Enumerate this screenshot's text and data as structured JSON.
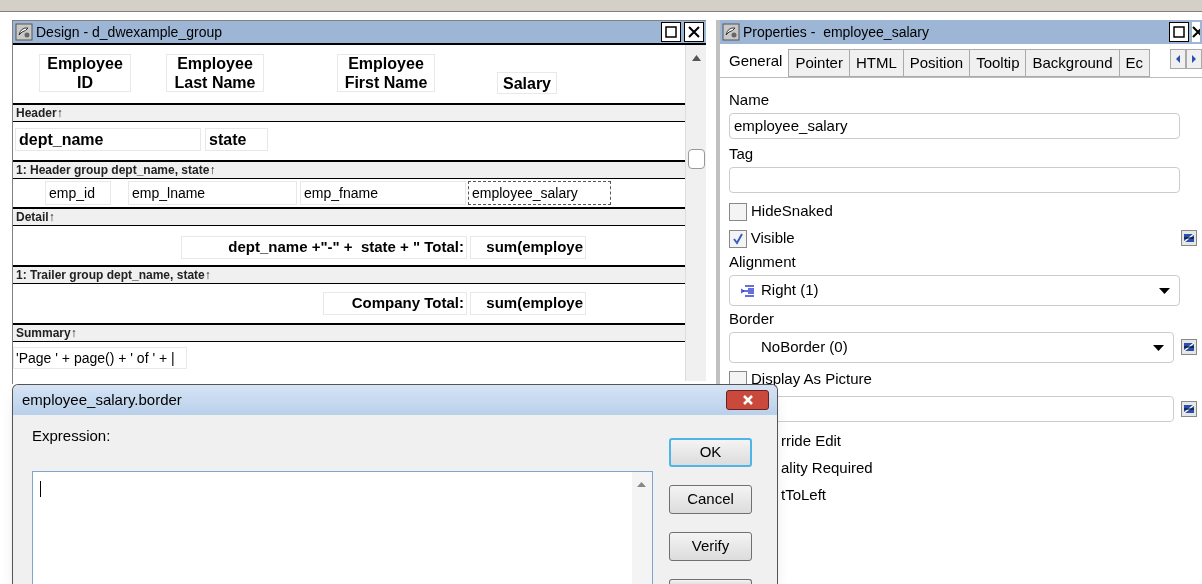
{
  "design_window": {
    "title": "Design - d_dwexample_group",
    "rows": [
      {
        "kind": "headings",
        "fields": [
          {
            "text": "Employee\nID",
            "selected": false
          },
          {
            "text": "Employee\nLast Name",
            "selected": false
          },
          {
            "text": "Employee\nFirst Name",
            "selected": false
          },
          {
            "text": "Salary",
            "selected": false
          }
        ]
      },
      {
        "kind": "band",
        "label": "Header↑"
      },
      {
        "kind": "group",
        "fields": [
          {
            "text": "dept_name",
            "selected": false
          },
          {
            "text": "state",
            "selected": false
          }
        ]
      },
      {
        "kind": "band",
        "label": "1: Header group dept_name, state↑"
      },
      {
        "kind": "detail",
        "fields": [
          {
            "text": "emp_id",
            "selected": false
          },
          {
            "text": "emp_lname",
            "selected": false
          },
          {
            "text": "emp_fname",
            "selected": false
          },
          {
            "text": "employee_salary",
            "selected": true
          }
        ]
      },
      {
        "kind": "band",
        "label": "Detail↑"
      },
      {
        "kind": "total",
        "fields": [
          {
            "text": "dept_name +\"-\" +  state + \" Total:",
            "selected": false
          },
          {
            "text": "sum(employe",
            "selected": false
          }
        ]
      },
      {
        "kind": "band",
        "label": "1: Trailer group dept_name, state↑"
      },
      {
        "kind": "trailer",
        "fields": [
          {
            "text": "Company Total:",
            "selected": false
          },
          {
            "text": "sum(employe",
            "selected": false
          }
        ]
      },
      {
        "kind": "band",
        "label": "Summary↑"
      },
      {
        "kind": "footer",
        "fields": [
          {
            "text": "'Page ' + page() + ' of ' + |",
            "selected": false
          }
        ]
      }
    ]
  },
  "properties_window": {
    "title": "Properties -  employee_salary",
    "tabs": [
      {
        "label": "General",
        "selected": true
      },
      {
        "label": "Pointer",
        "selected": false
      },
      {
        "label": "HTML",
        "selected": false
      },
      {
        "label": "Position",
        "selected": false
      },
      {
        "label": "Tooltip",
        "selected": false
      },
      {
        "label": "Background",
        "selected": false
      },
      {
        "label": "Ec",
        "selected": false
      }
    ],
    "items": [
      {
        "kind": "text_field",
        "label": "Name",
        "value": "employee_salary"
      },
      {
        "kind": "text_field",
        "label": "Tag"
      },
      {
        "kind": "checkbox",
        "label": "HideSnaked",
        "checked": false
      },
      {
        "kind": "checkbox",
        "label": "Visible",
        "checked": true,
        "expression": true
      },
      {
        "kind": "dropdown",
        "label": "Alignment",
        "value": "Right (1)"
      },
      {
        "kind": "dropdown",
        "label": "Border",
        "value": "NoBorder (0)",
        "expression": true
      },
      {
        "kind": "checkbox",
        "label": "Display As Picture",
        "checked": false
      },
      {
        "kind": "text_field",
        "expression": true
      },
      {
        "kind": "partial",
        "label": "rride Edit"
      },
      {
        "kind": "partial",
        "label": "ality Required"
      },
      {
        "kind": "partial",
        "label": "tToLeft"
      }
    ]
  },
  "dialog": {
    "title": "employee_salary.border",
    "field_label": "Expression:",
    "buttons": [
      {
        "label": "OK",
        "default": true
      },
      {
        "label": "Cancel",
        "default": false
      },
      {
        "label": "Verify",
        "default": false
      }
    ]
  }
}
